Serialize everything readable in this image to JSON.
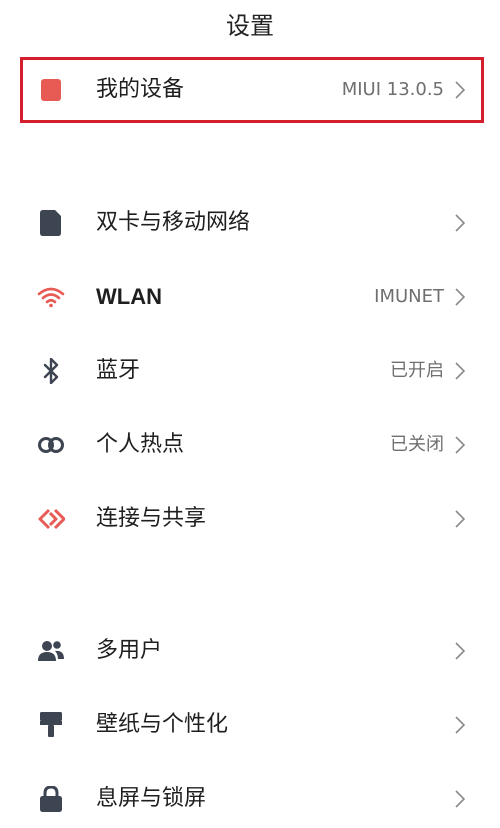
{
  "header": {
    "title": "设置"
  },
  "device": {
    "label": "我的设备",
    "value": "MIUI 13.0.5",
    "icon": "device-square-icon"
  },
  "network": [
    {
      "label": "双卡与移动网络",
      "value": "",
      "icon": "sim-card-icon"
    },
    {
      "label": "WLAN",
      "value": "IMUNET",
      "icon": "wifi-icon"
    },
    {
      "label": "蓝牙",
      "value": "已开启",
      "icon": "bluetooth-icon"
    },
    {
      "label": "个人热点",
      "value": "已关闭",
      "icon": "hotspot-icon"
    },
    {
      "label": "连接与共享",
      "value": "",
      "icon": "share-connection-icon"
    }
  ],
  "personal": [
    {
      "label": "多用户",
      "value": "",
      "icon": "users-icon"
    },
    {
      "label": "壁纸与个性化",
      "value": "",
      "icon": "paint-roller-icon"
    },
    {
      "label": "息屏与锁屏",
      "value": "",
      "icon": "lock-icon"
    }
  ],
  "colors": {
    "highlight_border": "#d21f2b",
    "accent_red": "#e85a54",
    "icon_dark": "#3d4452",
    "secondary_text": "#6f6f6f"
  }
}
